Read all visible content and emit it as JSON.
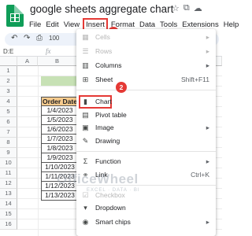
{
  "app": {
    "title": "google sheets aggregate chart",
    "icons": [
      "star-icon",
      "folder-move-icon",
      "cloud-status-icon"
    ]
  },
  "menubar": {
    "items": [
      "File",
      "Edit",
      "View",
      "Insert",
      "Format",
      "Data",
      "Tools",
      "Extensions",
      "Help"
    ],
    "active": "Insert"
  },
  "callouts": {
    "step1": "1",
    "step2": "2"
  },
  "toolbar": {
    "zoom_label": "100"
  },
  "formula_bar": {
    "name_box": "D:E",
    "fx": "fx"
  },
  "grid": {
    "columns": [
      "A",
      "B"
    ],
    "rows": [
      "1",
      "2",
      "3",
      "4",
      "5",
      "6",
      "7",
      "8",
      "9",
      "10",
      "11",
      "12",
      "13",
      "14",
      "15",
      "16"
    ],
    "header": "Order Date",
    "dates": [
      "1/4/2023",
      "1/5/2023",
      "1/6/2023",
      "1/7/2023",
      "1/8/2023",
      "1/9/2023",
      "1/10/2023",
      "1/11/2023",
      "1/12/2023",
      "1/13/2023"
    ]
  },
  "menu": {
    "cells": "Cells",
    "rows": "Rows",
    "columns": "Columns",
    "sheet": "Sheet",
    "sheet_shortcut": "Shift+F11",
    "chart": "Chart",
    "pivot_table": "Pivot table",
    "image": "Image",
    "drawing": "Drawing",
    "function": "Function",
    "link": "Link",
    "link_shortcut": "Ctrl+K",
    "checkbox": "Checkbox",
    "dropdown": "Dropdown",
    "smart_chips": "Smart chips"
  },
  "watermark": {
    "text": "OfficeWheel",
    "sub": "EXCEL  ·  DATA  ·  BI"
  },
  "colors": {
    "highlight": "#e53935",
    "header_fill": "#f7cb8d",
    "band_fill": "#c7e1b5",
    "sheets_green": "#0f9d58"
  }
}
